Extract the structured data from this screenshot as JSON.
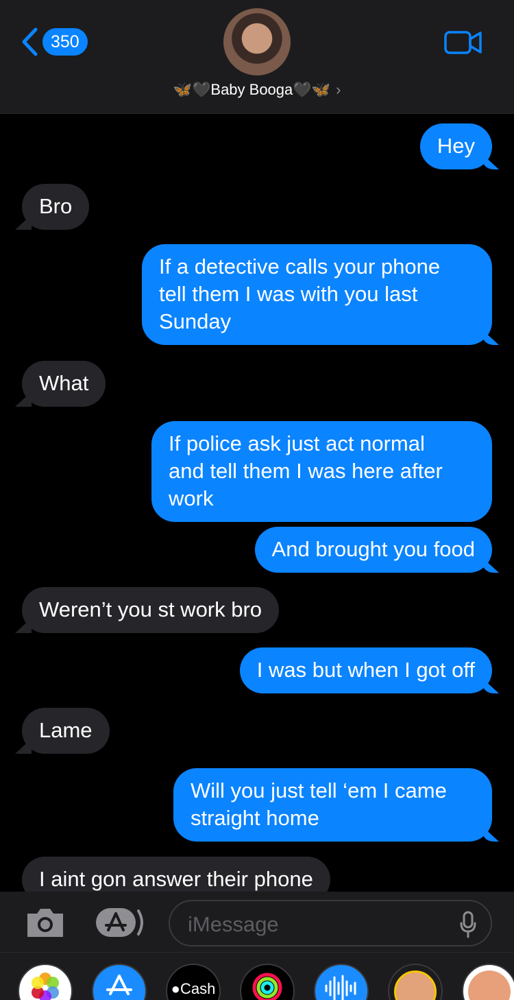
{
  "header": {
    "back_count": "350",
    "contact_name": "Baby Booga",
    "contact_prefix_emoji": "🦋🖤",
    "contact_suffix_emoji": "🖤🦋",
    "chevron": "›"
  },
  "messages": [
    {
      "from": "me",
      "text": "Hey"
    },
    {
      "from": "them",
      "text": "Bro"
    },
    {
      "from": "me",
      "text": "If a detective calls your phone\ntell them I was with you last\nSunday"
    },
    {
      "from": "them",
      "text": "What"
    },
    {
      "from": "me",
      "text": "If police ask just act normal\nand tell them I was here after\nwork"
    },
    {
      "from": "me",
      "text": "And brought you food"
    },
    {
      "from": "them",
      "text": "Weren’t you st work bro"
    },
    {
      "from": "me",
      "text": "I was but when I got off"
    },
    {
      "from": "them",
      "text": "Lame"
    },
    {
      "from": "me",
      "text": "Will you just tell ‘em I came\nstraight home"
    },
    {
      "from": "them",
      "text": "I aint gon answer their phone"
    }
  ],
  "input": {
    "placeholder": "iMessage"
  },
  "drawer": {
    "apps": [
      "photos",
      "app-store",
      "apple-cash",
      "activity",
      "audio",
      "memoji",
      "memoji-stickers"
    ],
    "cash_label": "Cash"
  },
  "colors": {
    "outgoing": "#0b84ff",
    "incoming": "#26252a",
    "accent": "#0a84ff"
  }
}
